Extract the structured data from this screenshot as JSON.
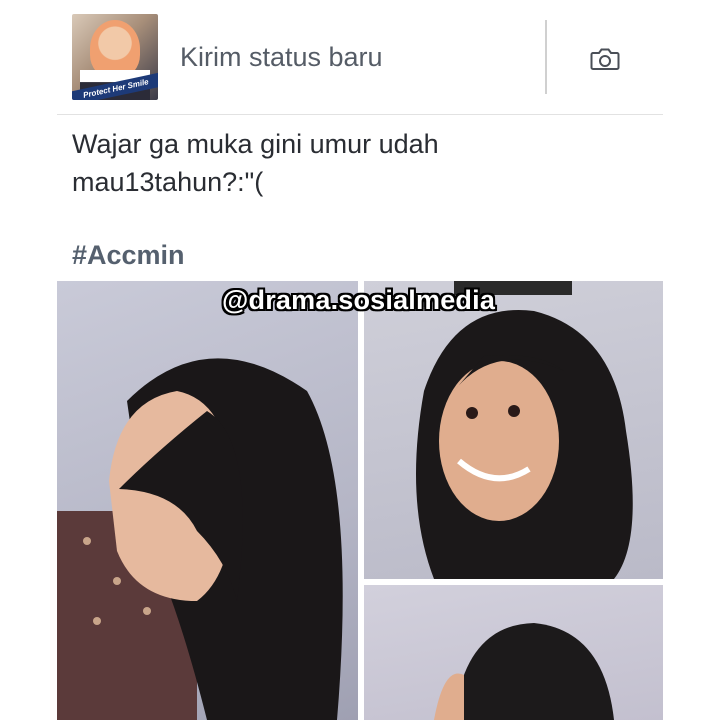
{
  "composer": {
    "avatar_banner": "Protect Her Smile",
    "new_status_label": "Kirim status baru",
    "camera_icon": "camera-icon"
  },
  "post": {
    "text": "Wajar ga muka gini umur udah mau13tahun?:\"(",
    "hashtag": "#Accmin",
    "watermark": "@drama.sosialmedia",
    "photos": [
      {
        "description_icon": "photo-girl-side-profile"
      },
      {
        "description_icon": "photo-girl-smiling"
      },
      {
        "description_icon": "photo-girl-partial"
      }
    ]
  },
  "colors": {
    "text_primary": "#2a2d33",
    "text_secondary": "#555c66",
    "divider": "#e2e2e2"
  }
}
